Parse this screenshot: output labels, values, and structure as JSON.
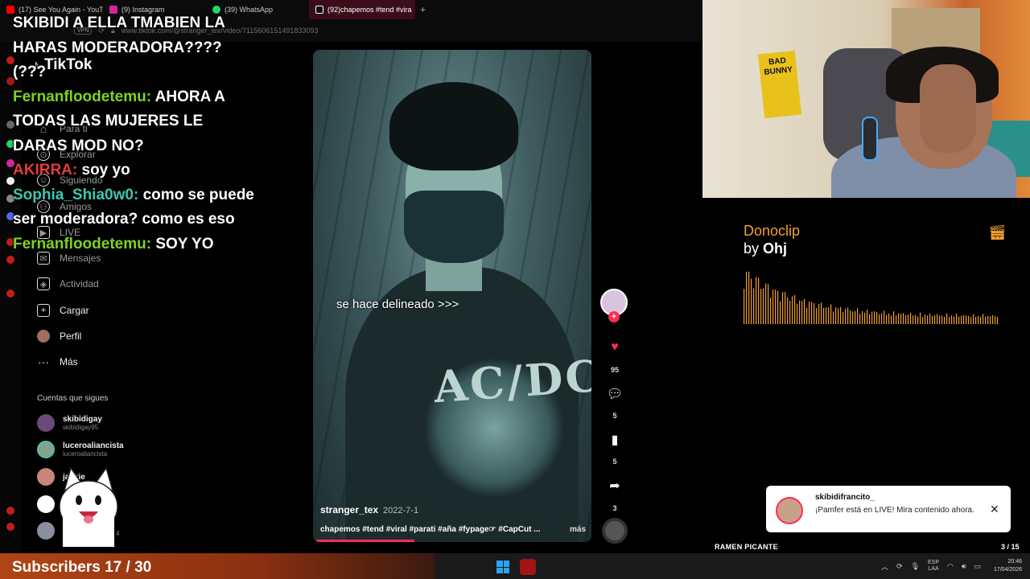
{
  "browser": {
    "tabs": [
      {
        "label": "(17) See You Again - YouTu",
        "color": "#ff0000"
      },
      {
        "label": "(9) Instagram",
        "color": "#d6249f"
      },
      {
        "label": "(39) WhatsApp",
        "color": "#25d366"
      },
      {
        "label": "(92)chapemos #tend #vira",
        "color": "#ffffff",
        "active": true
      }
    ],
    "new_tab": "+",
    "vpn": "VPN",
    "url": "www.tiktok.com/@stranger_tex/video/7115606151491833093"
  },
  "tiktok": {
    "logo": "TikTok",
    "nav": [
      {
        "label": "Para ti",
        "icon": "home-icon",
        "glyph": "⌂"
      },
      {
        "label": "Explorar",
        "icon": "compass-icon",
        "glyph": "⊙"
      },
      {
        "label": "Siguiendo",
        "icon": "following-icon",
        "glyph": "☺"
      },
      {
        "label": "Amigos",
        "icon": "friends-icon",
        "glyph": "⚇"
      },
      {
        "label": "LIVE",
        "icon": "live-icon",
        "glyph": "▶"
      },
      {
        "label": "Mensajes",
        "icon": "messages-icon",
        "glyph": "✉"
      },
      {
        "label": "Actividad",
        "icon": "activity-icon",
        "glyph": "◈"
      },
      {
        "label": "Cargar",
        "icon": "upload-icon",
        "glyph": "+"
      },
      {
        "label": "Perfil",
        "icon": "profile-avatar-icon",
        "glyph": ""
      },
      {
        "label": "Más",
        "icon": "more-icon",
        "glyph": "···"
      }
    ],
    "following_heading": "Cuentas que sigues",
    "following": [
      {
        "name": "skibidigay",
        "handle": "skibidigay95",
        "color": "#6a4a7a"
      },
      {
        "name": "luceroaliancista",
        "handle": "luceroaliancista",
        "color": "#8aa08a"
      },
      {
        "name": "jackie",
        "handle": "",
        "color": "#c8867a"
      },
      {
        "name": "",
        "handle": "",
        "color": "#ffffff"
      },
      {
        "name": "",
        "handle": "4",
        "color": "#8a8fa0"
      }
    ]
  },
  "chat": [
    {
      "user": "",
      "message": "SKIBIDI A ELLA TMABIEN LA HARAS MODERADORA???? (???",
      "color": ""
    },
    {
      "user": "Fernanfloodetemu:",
      "message": "AHORA A TODAS LAS MUJERES LE DARAS MOD NO?",
      "color": "green"
    },
    {
      "user": "AKIRRA:",
      "message": "soy yo",
      "color": "red"
    },
    {
      "user": "Sophia_Shia0w0:",
      "message": "como se puede ser moderadora? como es eso",
      "color": "teal"
    },
    {
      "user": "Fernanfloodetemu:",
      "message": "SOY YO",
      "color": "green"
    }
  ],
  "video": {
    "overlay_text": "se hace delineado >>>",
    "shirt_text": "AC/DC",
    "author": "stranger_tex",
    "date": "2022-7-1",
    "description": "chapemos #tend #viral #parati #aña #fypage☞ #CapCut ...",
    "more": "más",
    "progress": 0.36
  },
  "actions": {
    "follow_plus": "+",
    "likes": "95",
    "comments": "5",
    "saves": "5",
    "shares": "3"
  },
  "webcam": {
    "poster_text": "BAD BUNNY"
  },
  "donoclip": {
    "title": "Donoclip",
    "by_prefix": "by",
    "by_name": "Ohj",
    "accent": "#f0a030"
  },
  "notification": {
    "title": "skibidifrancito_",
    "body": "¡Pamfer está en LIVE! Mira contenido ahora.",
    "close": "✕"
  },
  "goal": {
    "label": "RAMEN PICANTE",
    "count": "3 / 15",
    "progress": 0.2
  },
  "taskbar": {
    "subscribers": "Subscribers 17 / 30",
    "lang_line1": "ESP",
    "lang_line2": "LAA",
    "time": "20:46",
    "date": "17/04/2026"
  }
}
